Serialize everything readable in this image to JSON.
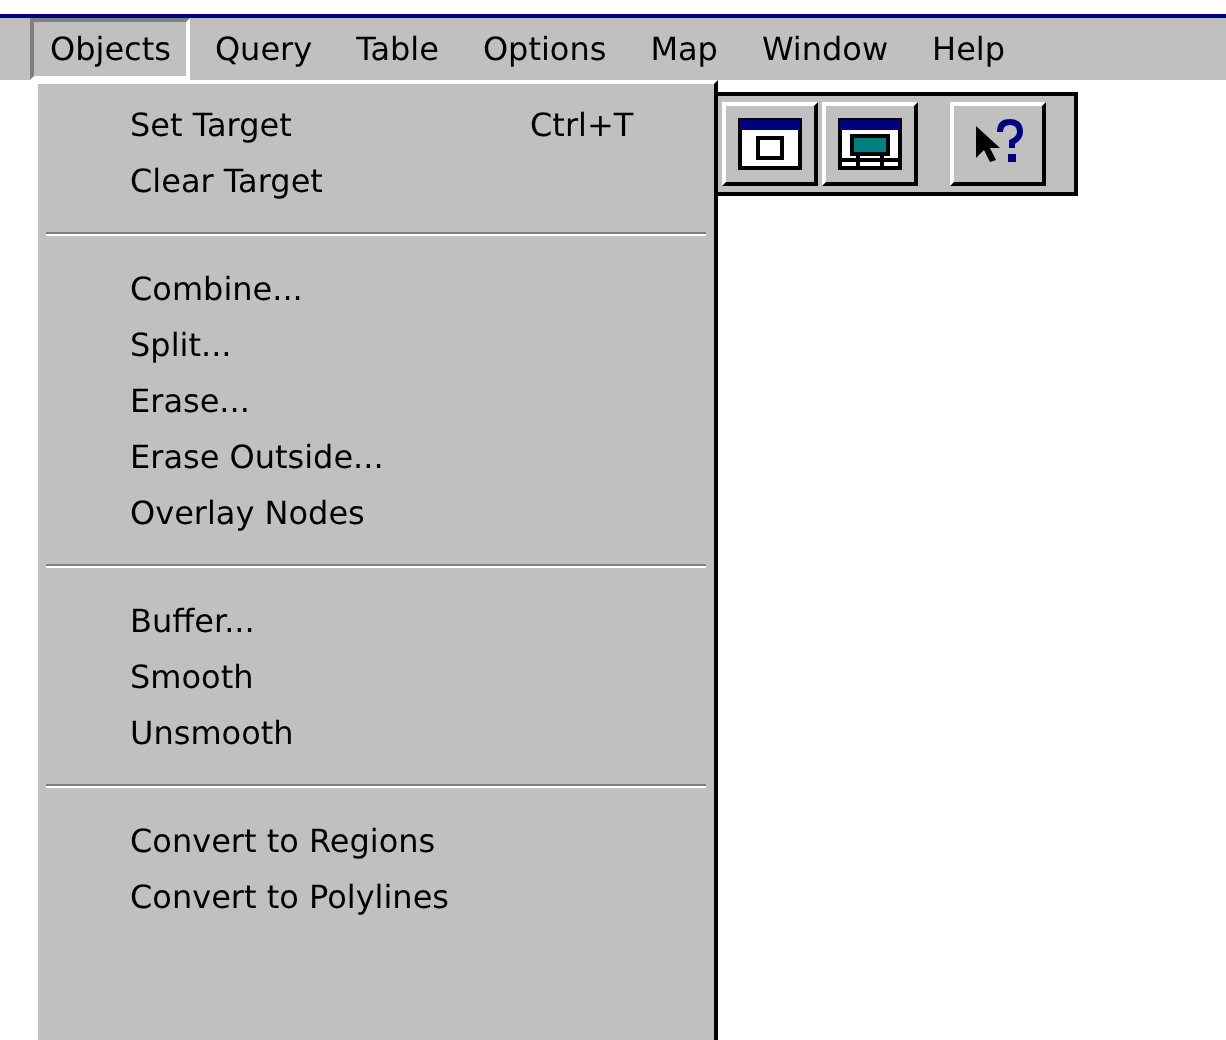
{
  "menu_bar": [
    {
      "label": "Objects",
      "selected": true
    },
    {
      "label": "Query",
      "selected": false
    },
    {
      "label": "Table",
      "selected": false
    },
    {
      "label": "Options",
      "selected": false
    },
    {
      "label": "Map",
      "selected": false
    },
    {
      "label": "Window",
      "selected": false
    },
    {
      "label": "Help",
      "selected": false
    }
  ],
  "dropdown": {
    "groups": [
      [
        {
          "label": "Set Target",
          "shortcut": "Ctrl+T"
        },
        {
          "label": "Clear Target"
        }
      ],
      [
        {
          "label": "Combine..."
        },
        {
          "label": "Split..."
        },
        {
          "label": "Erase..."
        },
        {
          "label": "Erase Outside..."
        },
        {
          "label": "Overlay Nodes"
        }
      ],
      [
        {
          "label": "Buffer..."
        },
        {
          "label": "Smooth"
        },
        {
          "label": "Unsmooth"
        }
      ],
      [
        {
          "label": "Convert to Regions"
        },
        {
          "label": "Convert to Polylines"
        }
      ]
    ]
  },
  "toolbar": [
    {
      "kind": "window"
    },
    {
      "kind": "layout"
    },
    {
      "kind": "help"
    }
  ]
}
